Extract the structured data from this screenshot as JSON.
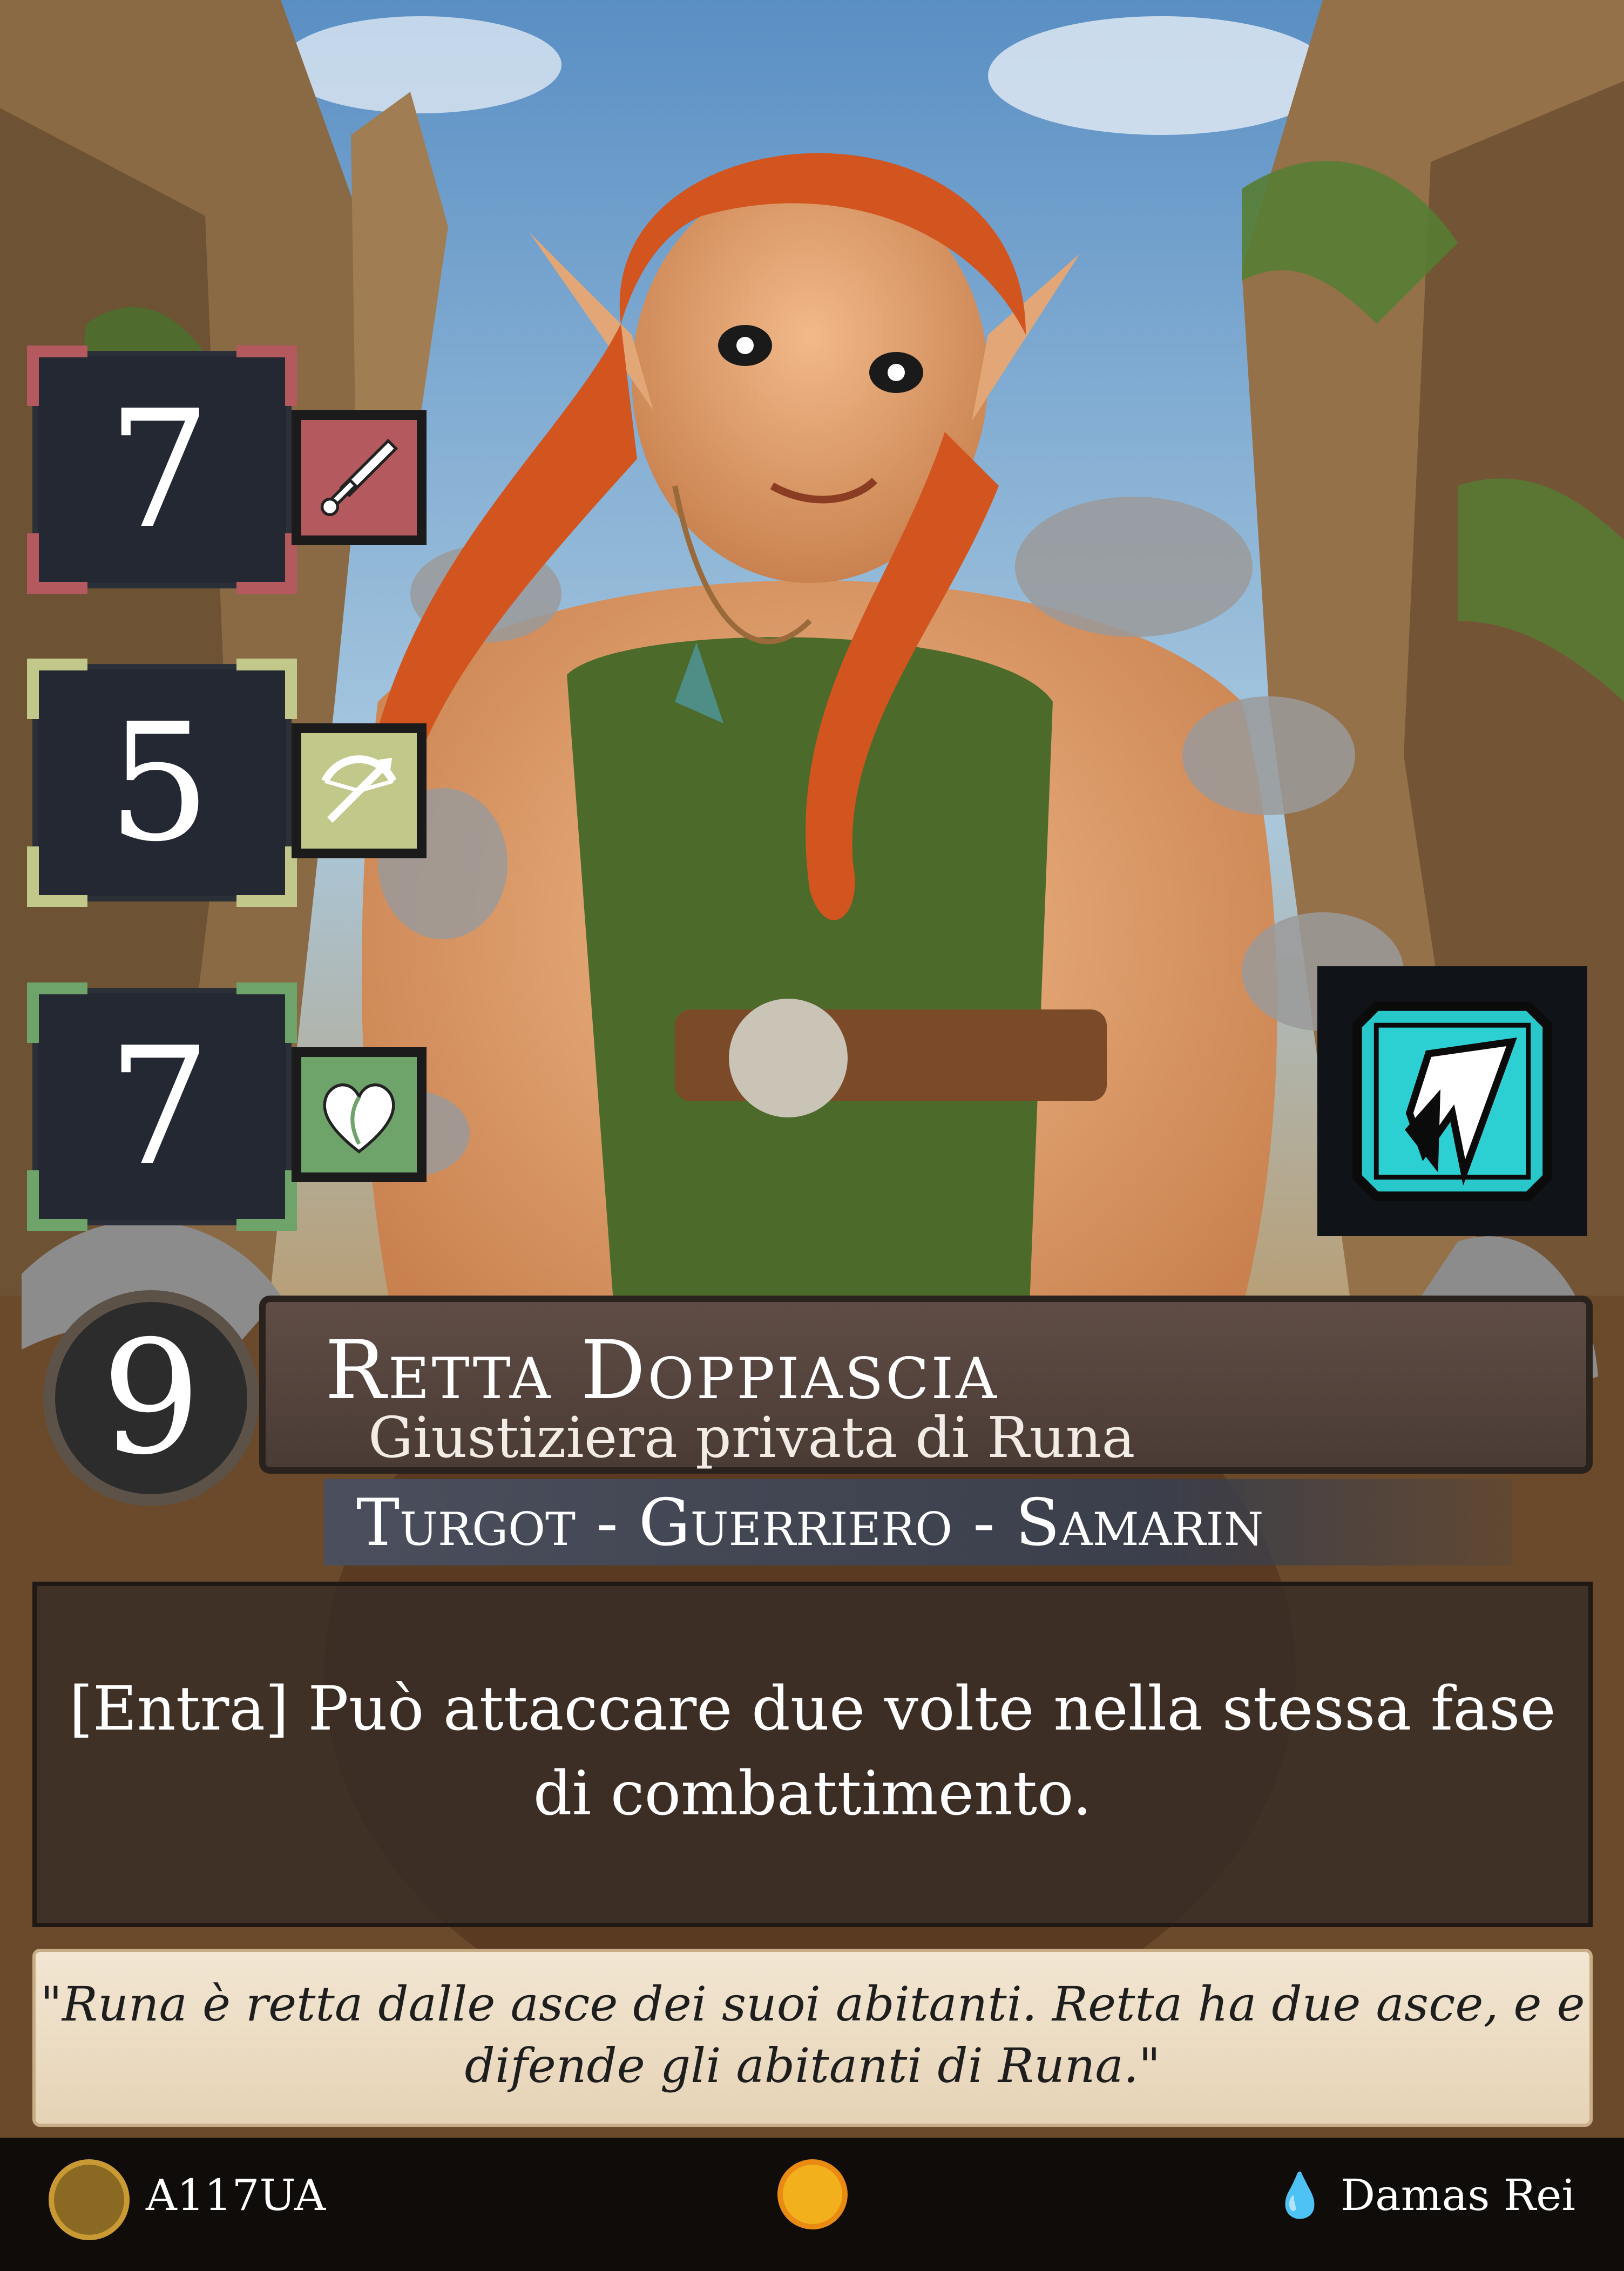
{
  "card": {
    "stats": {
      "attack": "7",
      "ranged": "5",
      "health": "7"
    },
    "cost": "9",
    "name": "Retta Doppiascia",
    "subtitle": "Giustiziera privata di Runa",
    "typeline": "Turgot - Guerriero - Samarin",
    "rules_text": "[Entra] Può attaccare due volte nella stessa fase di combattimento.",
    "flavor_text": "\"Runa è retta dalle asce dei suoi abitanti. Retta ha due asce, e e difende gli abitanti di Runa.\"",
    "set_code": "A117UA",
    "artist": "Damas Rei"
  },
  "colors": {
    "attack": "#b45a5e",
    "ranged": "#c2c78a",
    "health": "#6ea36a",
    "keyword": "#28c7c9"
  },
  "icons": {
    "attack_icon": "sword-icon",
    "ranged_icon": "crossbow-icon",
    "health_icon": "heart-icon",
    "keyword_icon": "lightning-banner-icon",
    "rarity_icon": "set-seal-icon",
    "faction_icon": "swirl-icon",
    "artist_icon": "drop-icon"
  }
}
